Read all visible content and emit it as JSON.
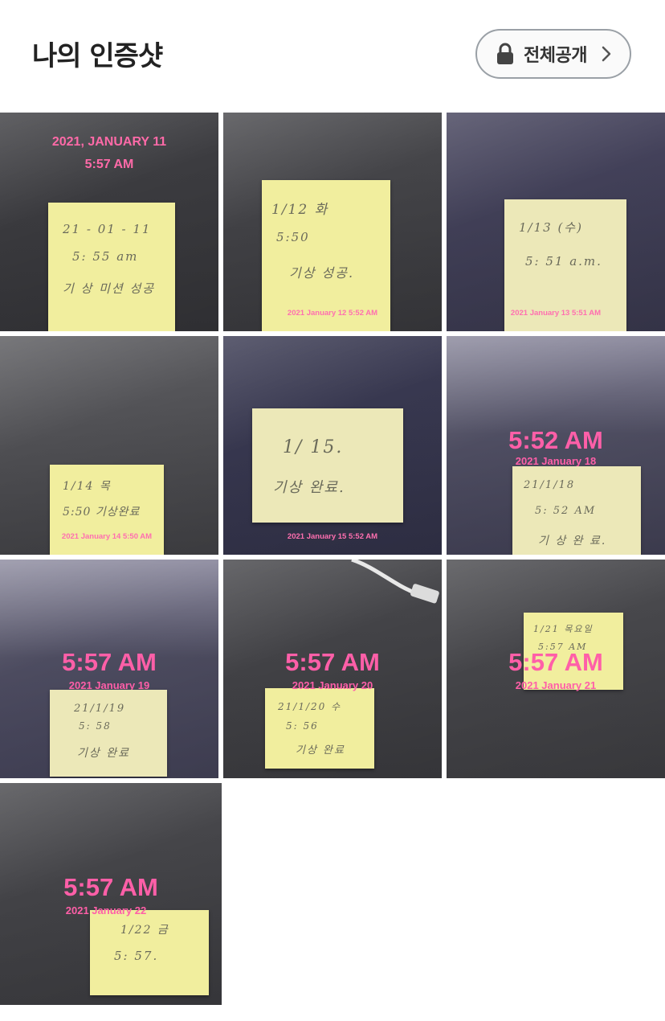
{
  "header": {
    "title": "나의 인증샷",
    "visibility_label": "전체공개",
    "lock_icon": "lock-icon",
    "chevron_icon": "chevron-right-icon"
  },
  "photos": [
    {
      "stamp_line1": "2021, JANUARY 11",
      "stamp_line2": "5:57 AM",
      "note_lines": [
        "21 - 01 - 11",
        "5: 55 am",
        "기 상 미션 성공"
      ]
    },
    {
      "stamp_small": "2021 January 12 5:52 AM",
      "note_lines": [
        "1/12 화",
        "5:50",
        "기상 성공."
      ]
    },
    {
      "stamp_small": "2021 January 13 5:51 AM",
      "note_lines": [
        "1/13 (수)",
        "5: 51 a.m."
      ]
    },
    {
      "stamp_small": "2021 January 14 5:50 AM",
      "note_lines": [
        "1/14 목",
        "5:50 기상완료"
      ]
    },
    {
      "stamp_small": "2021 January 15 5:52 AM",
      "note_lines": [
        "1/ 15.",
        "기상 완료."
      ]
    },
    {
      "stamp_time": "5:52 AM",
      "stamp_date": "2021 January 18",
      "note_lines": [
        "21/1/18",
        "5: 52 AM",
        "기 상 완 료."
      ]
    },
    {
      "stamp_time": "5:57 AM",
      "stamp_date": "2021 January 19",
      "note_lines": [
        "21/1/19",
        "5: 58",
        "기상 완료"
      ]
    },
    {
      "stamp_time": "5:57 AM",
      "stamp_date": "2021 January 20",
      "note_lines": [
        "21/1/20 수",
        "5: 56",
        "기상 완료"
      ]
    },
    {
      "stamp_time": "5:57 AM",
      "stamp_date": "2021 January 21",
      "note_lines": [
        "1/21 목요일",
        "5:57 AM"
      ]
    },
    {
      "stamp_time": "5:57 AM",
      "stamp_date": "2021 January 22",
      "note_lines": [
        "1/22 금",
        "5: 57."
      ]
    }
  ]
}
